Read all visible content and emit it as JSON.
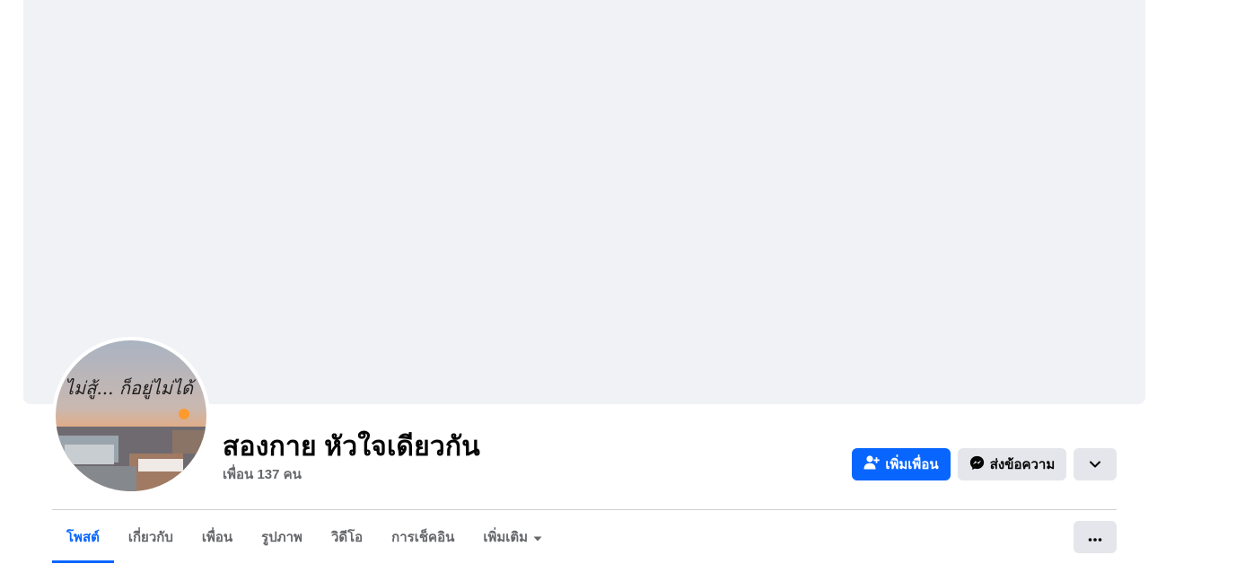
{
  "profile": {
    "name": "สองกาย หัวใจเดียวกัน",
    "friends_count": "เพื่อน 137 คน",
    "avatar_caption": "ไม่สู้... ก็อยู่ไม่ได้"
  },
  "actions": {
    "add_friend": "เพิ่มเพื่อน",
    "message": "ส่งข้อความ"
  },
  "tabs": [
    {
      "label": "โพสต์",
      "active": true
    },
    {
      "label": "เกี่ยวกับ",
      "active": false
    },
    {
      "label": "เพื่อน",
      "active": false
    },
    {
      "label": "รูปภาพ",
      "active": false
    },
    {
      "label": "วิดีโอ",
      "active": false
    },
    {
      "label": "การเช็คอิน",
      "active": false
    },
    {
      "label": "เพิ่มเติม",
      "active": false
    }
  ],
  "icons": {
    "add_friend": "person-plus-icon",
    "message": "messenger-icon",
    "dropdown": "chevron-down-icon",
    "more_tab": "caret-down-icon",
    "options": "ellipsis-icon"
  },
  "colors": {
    "primary": "#0866ff",
    "secondary_button": "#e4e6eb",
    "cover": "#f0f2f5",
    "muted_text": "#65676b"
  }
}
